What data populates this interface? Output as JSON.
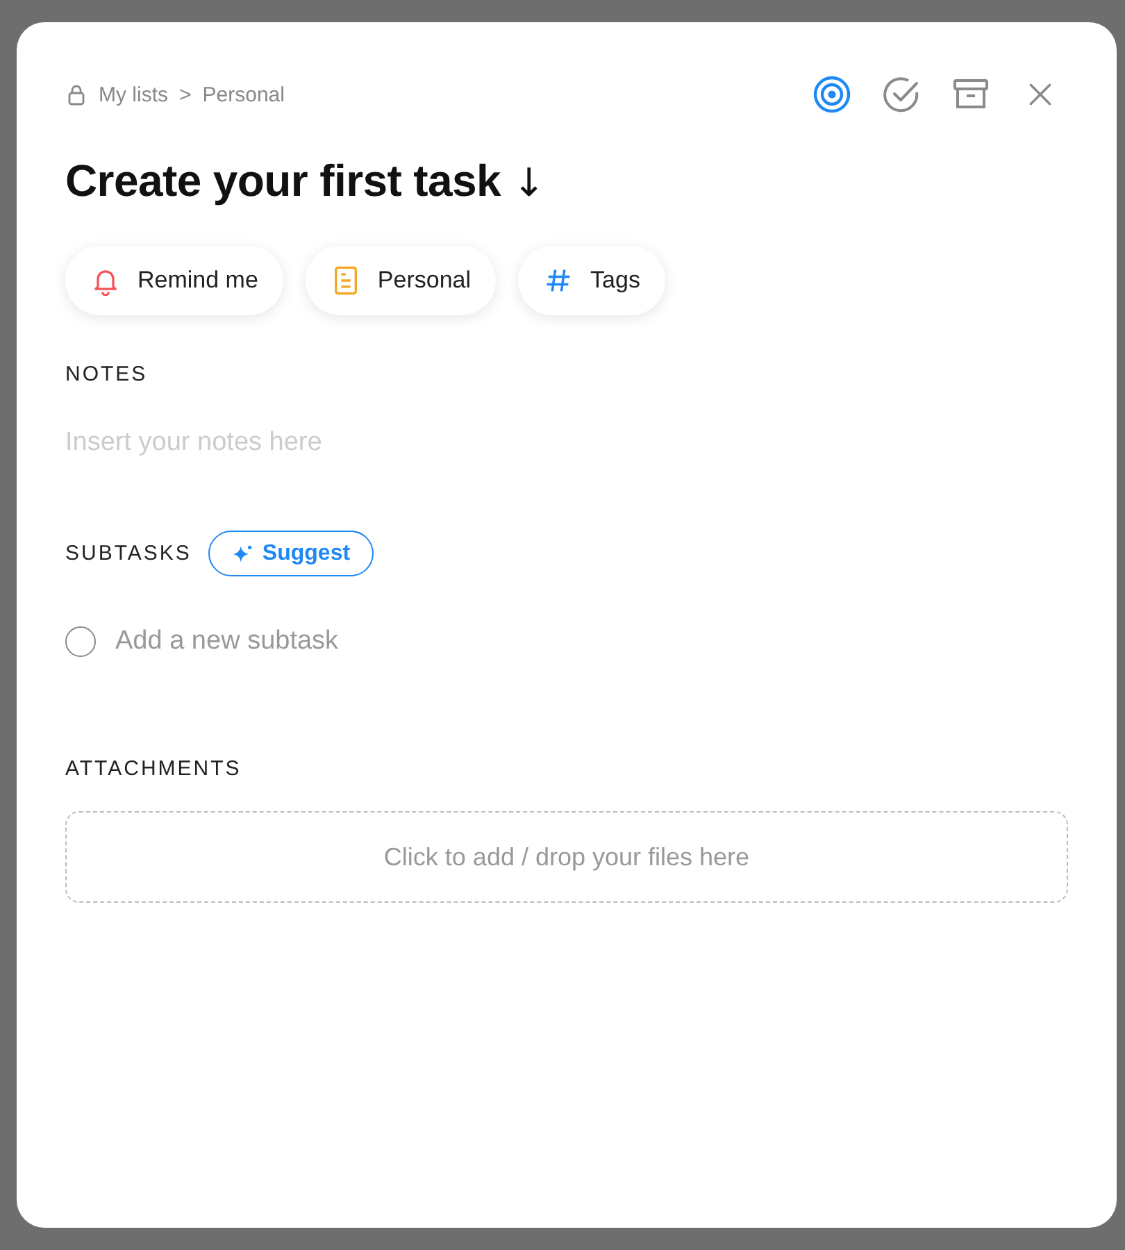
{
  "breadcrumb": [
    "My lists",
    "Personal"
  ],
  "breadcrumb_separator": ">",
  "toolbar": [
    {
      "kind": "focus",
      "selected": true
    },
    {
      "kind": "complete",
      "selected": false
    },
    {
      "kind": "archive",
      "selected": false
    },
    {
      "kind": "close",
      "selected": false
    }
  ],
  "title": "Create your first task",
  "title_icon": "↓",
  "chips": [
    {
      "kind": "bell",
      "label": "Remind me",
      "color": "#f2555a"
    },
    {
      "kind": "list",
      "label": "Personal",
      "color": "#f5a623"
    },
    {
      "kind": "hash",
      "label": "Tags",
      "color": "#1e88f5"
    }
  ],
  "notes": {
    "heading": "NOTES",
    "placeholder": "Insert your notes here"
  },
  "subtasks": {
    "heading": "SUBTASKS",
    "suggest_label": "Suggest",
    "items": [
      {
        "placeholder": "Add a new subtask",
        "checked": false
      }
    ]
  },
  "attachments": {
    "heading": "ATTACHMENTS",
    "dropzone": "Click to add / drop your files here"
  }
}
